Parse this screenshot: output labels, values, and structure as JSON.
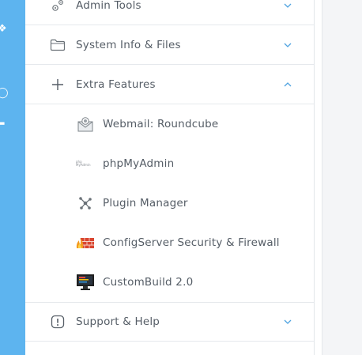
{
  "menu": {
    "admin_tools": {
      "label": "Admin Tools",
      "expanded": false
    },
    "system_info": {
      "label": "System Info & Files",
      "expanded": false
    },
    "extra_features": {
      "label": "Extra Features",
      "expanded": true,
      "items": [
        {
          "label": "Webmail: Roundcube",
          "icon": "envelope-icon"
        },
        {
          "label": "phpMyAdmin",
          "icon": "phpmyadmin-icon",
          "icon_text": "php MyAdmin"
        },
        {
          "label": "Plugin Manager",
          "icon": "plugin-network-icon"
        },
        {
          "label": "ConfigServer Security & Firewall",
          "icon": "firewall-icon"
        },
        {
          "label": "CustomBuild 2.0",
          "icon": "monitor-icon"
        }
      ]
    },
    "support_help": {
      "label": "Support & Help",
      "expanded": false
    }
  },
  "colors": {
    "sidebar_strip": "#5db4ef",
    "accent_chevron": "#4fa3e0",
    "text": "#555d66",
    "divider": "#e6e9ed"
  }
}
